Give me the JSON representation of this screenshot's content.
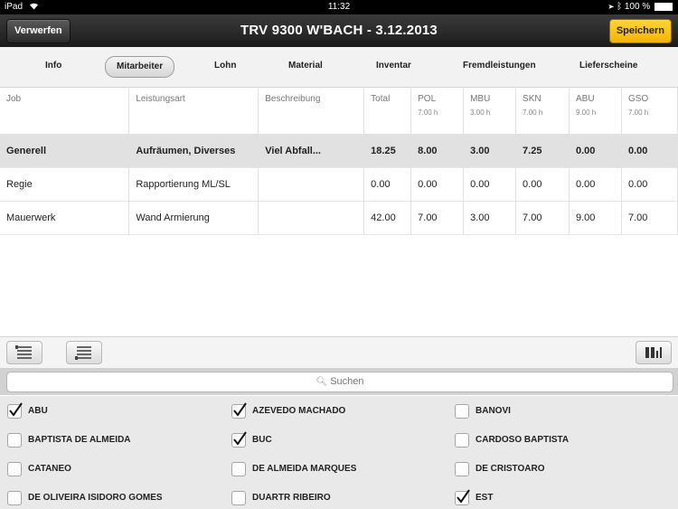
{
  "status": {
    "device": "iPad",
    "time": "11:32",
    "battery": "100 %"
  },
  "nav": {
    "back_label": "Verwerfen",
    "title": "TRV 9300 W'BACH - 3.12.2013",
    "save_label": "Speichern"
  },
  "tabs": [
    "Info",
    "Mitarbeiter",
    "Lohn",
    "Material",
    "Inventar",
    "Fremdleistungen",
    "Lieferscheine"
  ],
  "table": {
    "headers": [
      {
        "label": "Job",
        "sub": ""
      },
      {
        "label": "Leistungsart",
        "sub": ""
      },
      {
        "label": "Beschreibung",
        "sub": ""
      },
      {
        "label": "Total",
        "sub": ""
      },
      {
        "label": "POL",
        "sub": "7.00 h"
      },
      {
        "label": "MBU",
        "sub": "3.00 h"
      },
      {
        "label": "SKN",
        "sub": "7.00 h"
      },
      {
        "label": "ABU",
        "sub": "9.00 h"
      },
      {
        "label": "GSO",
        "sub": "7.00 h"
      }
    ],
    "rows": [
      [
        "Generell",
        "Aufräumen, Diverses",
        "Viel Abfall...",
        "18.25",
        "8.00",
        "3.00",
        "7.25",
        "0.00",
        "0.00"
      ],
      [
        "Regie",
        "Rapportierung ML/SL",
        "",
        "0.00",
        "0.00",
        "0.00",
        "0.00",
        "0.00",
        "0.00"
      ],
      [
        "Mauerwerk",
        "Wand Armierung",
        "",
        "42.00",
        "7.00",
        "3.00",
        "7.00",
        "9.00",
        "7.00"
      ]
    ],
    "selected_row": 0
  },
  "search": {
    "placeholder": "Suchen"
  },
  "people": [
    {
      "name": "ABU",
      "checked": true
    },
    {
      "name": "AZEVEDO MACHADO",
      "checked": true
    },
    {
      "name": "BANOVI",
      "checked": false
    },
    {
      "name": "BAPTISTA DE ALMEIDA",
      "checked": false
    },
    {
      "name": "BUC",
      "checked": true
    },
    {
      "name": "CARDOSO BAPTISTA",
      "checked": false
    },
    {
      "name": "CATANEO",
      "checked": false
    },
    {
      "name": "DE ALMEIDA MARQUES",
      "checked": false
    },
    {
      "name": "DE CRISTOARO",
      "checked": false
    },
    {
      "name": "DE OLIVEIRA ISIDORO GOMES",
      "checked": false
    },
    {
      "name": "DUARTR RIBEIRO",
      "checked": false
    },
    {
      "name": "EST",
      "checked": true
    }
  ]
}
